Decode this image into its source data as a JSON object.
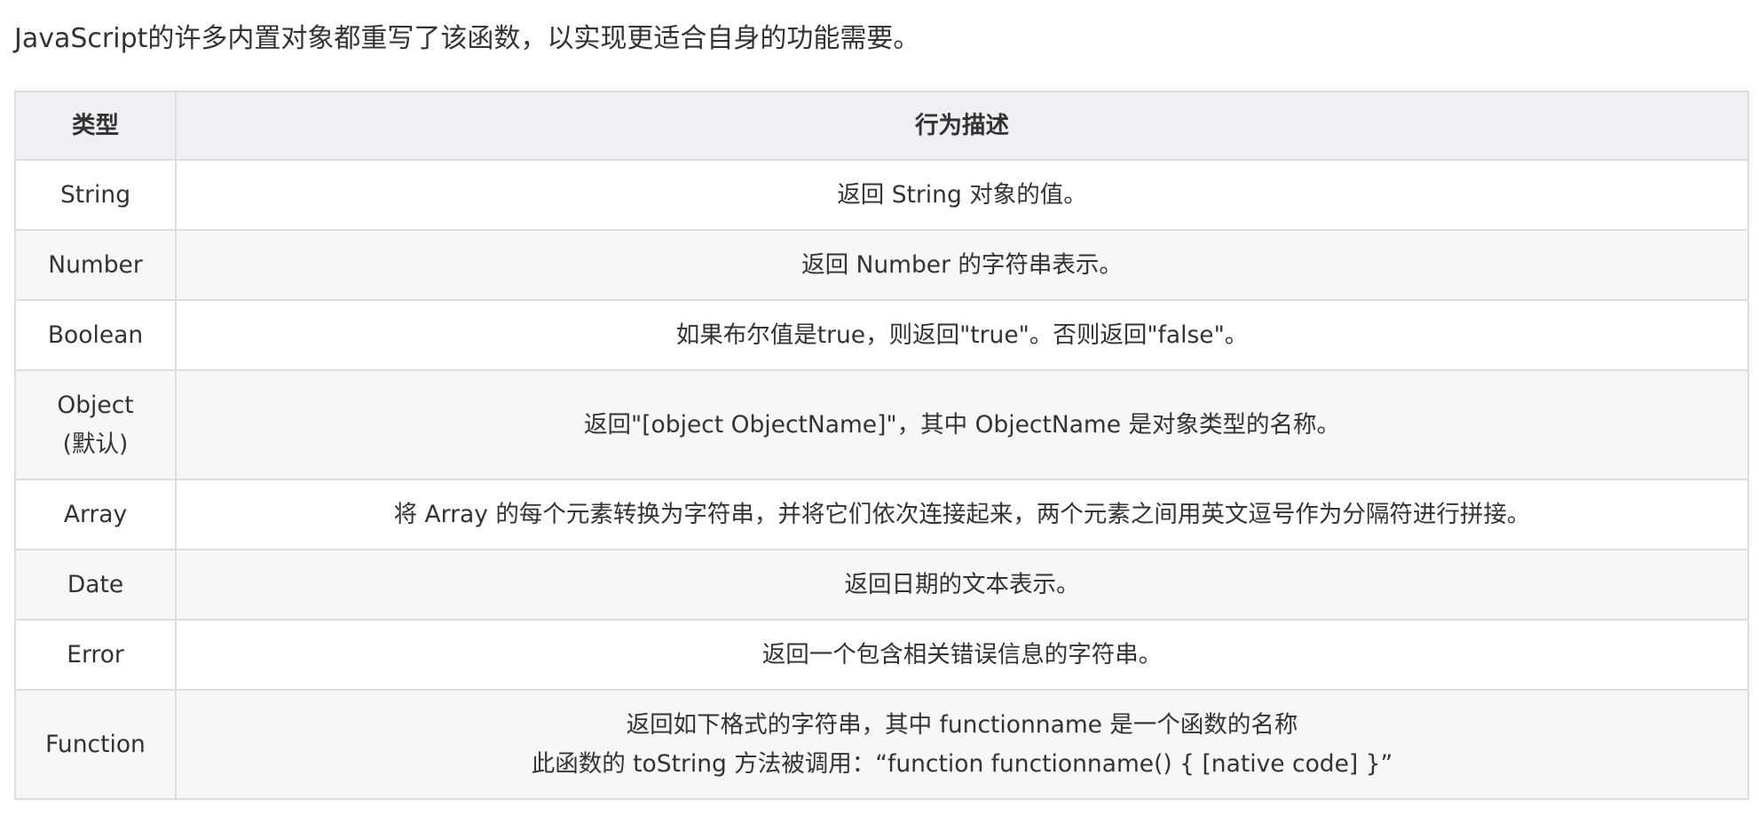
{
  "intro": "JavaScript的许多内置对象都重写了该函数，以实现更适合自身的功能需要。",
  "table": {
    "headers": [
      "类型",
      "行为描述"
    ],
    "rows": [
      {
        "type": [
          "String"
        ],
        "desc": [
          "返回 String 对象的值。"
        ]
      },
      {
        "type": [
          "Number"
        ],
        "desc": [
          "返回 Number 的字符串表示。"
        ]
      },
      {
        "type": [
          "Boolean"
        ],
        "desc": [
          "如果布尔值是true，则返回\"true\"。否则返回\"false\"。"
        ]
      },
      {
        "type": [
          "Object",
          "(默认)"
        ],
        "desc": [
          "返回\"[object ObjectName]\"，其中 ObjectName 是对象类型的名称。"
        ]
      },
      {
        "type": [
          "Array"
        ],
        "desc": [
          "将 Array 的每个元素转换为字符串，并将它们依次连接起来，两个元素之间用英文逗号作为分隔符进行拼接。"
        ]
      },
      {
        "type": [
          "Date"
        ],
        "desc": [
          "返回日期的文本表示。"
        ]
      },
      {
        "type": [
          "Error"
        ],
        "desc": [
          "返回一个包含相关错误信息的字符串。"
        ]
      },
      {
        "type": [
          "Function"
        ],
        "desc": [
          "返回如下格式的字符串，其中 functionname 是一个函数的名称",
          "此函数的 toString 方法被调用：“function functionname() { [native code] }”"
        ]
      }
    ]
  }
}
